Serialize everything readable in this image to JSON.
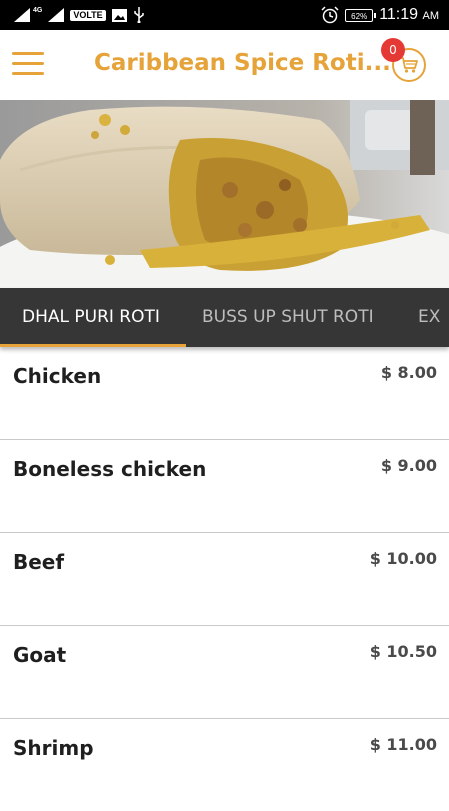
{
  "status_bar": {
    "network": "4G",
    "volte": "VOLTE",
    "battery": "62%",
    "time": "11:19",
    "ampm": "AM"
  },
  "app_bar": {
    "title": "Caribbean Spice Roti...",
    "cart_count": "0"
  },
  "tabs": [
    {
      "label": "DHAL PURI ROTI",
      "active": true
    },
    {
      "label": "BUSS UP SHUT ROTI",
      "active": false
    },
    {
      "label": "EX",
      "active": false
    }
  ],
  "items": [
    {
      "name": "Chicken",
      "price": "$ 8.00"
    },
    {
      "name": "Boneless chicken",
      "price": "$ 9.00"
    },
    {
      "name": "Beef",
      "price": "$ 10.00"
    },
    {
      "name": "Goat",
      "price": "$ 10.50"
    },
    {
      "name": "Shrimp",
      "price": "$ 11.00"
    }
  ],
  "colors": {
    "accent": "#e5a33a",
    "tab_bar": "#363636",
    "badge": "#e53935"
  },
  "icons": {
    "menu": "hamburger-menu-icon",
    "cart": "shopping-cart-icon"
  }
}
